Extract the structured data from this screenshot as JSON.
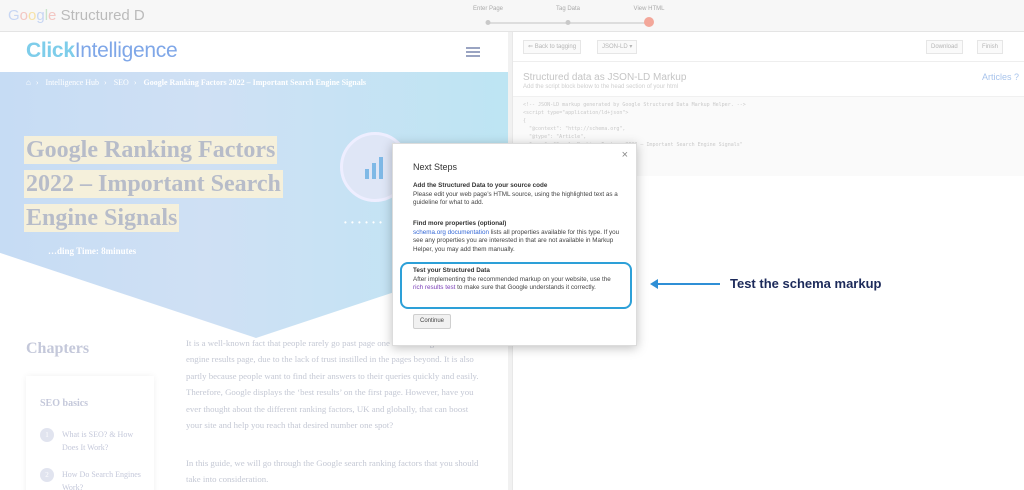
{
  "topbar": {
    "logo": {
      "google": "Google",
      "product": "Structured D"
    },
    "steps": [
      {
        "label": "Enter Page"
      },
      {
        "label": "Tag Data"
      },
      {
        "label": "View HTML"
      }
    ],
    "active_step": "View HTML"
  },
  "site": {
    "brand_bold": "Click",
    "brand_light": "Intelligence",
    "breadcrumb": [
      "Intelligence Hub",
      "SEO",
      "Google Ranking Factors 2022 – Important Search Engine Signals"
    ],
    "hero_title_lines": [
      "Google Ranking Factors",
      "2022 – Important Search",
      "Engine Signals"
    ],
    "reading_time": "…ding Time: 8minutes",
    "chapters_heading": "Chapters",
    "seo_card": {
      "heading": "SEO basics",
      "items": [
        {
          "num": "1",
          "text": "What is SEO? & How Does It Work?"
        },
        {
          "num": "2",
          "text": "How Do Search Engines Work?"
        }
      ]
    },
    "body_paragraph_1": "It is a well-known fact that people rarely go past page one of the Google search engine results page, due to the lack of trust instilled in the pages beyond. It is also partly because people want to find their answers to their queries quickly and easily. Therefore, Google displays the ‘best results’ on the first page. However, have you ever thought about the different ranking factors, UK and globally, that can boost your site and help you reach that desired number one spot?",
    "body_paragraph_2": "In this guide, we will go through the Google search ranking factors that you should take into consideration."
  },
  "panel": {
    "back_button": "Back to tagging",
    "format_select": "JSON-LD",
    "download_button": "Download",
    "finish_button": "Finish",
    "title": "Structured data as JSON-LD Markup",
    "subtitle": "Add the script block below to the head section of your html",
    "articles_label": "Articles",
    "code_lines": [
      "<!-- JSON-LD markup generated by Google Structured Data Markup Helper. -->",
      "<script type=\"application/ld+json\">",
      "{",
      "  \"@context\": \"http://schema.org\",",
      "  \"@type\": \"Article\",",
      "  \"name\": \"Google Ranking Factors 2022 – Important Search Engine Signals\"",
      "}"
    ]
  },
  "modal": {
    "title": "Next Steps",
    "close_symbol": "×",
    "sections": [
      {
        "heading": "Add the Structured Data to your source code",
        "text": "Please edit your web page’s HTML source, using the highlighted text as a guideline for what to add."
      },
      {
        "heading": "Find more properties (optional)",
        "link": "schema.org documentation",
        "text": " lists all properties available for this type. If you see any properties you are interested in that are not available in Markup Helper, you may add them manually."
      },
      {
        "heading": "Test your Structured Data",
        "text_before": "After implementing the recommended markup on your website, use the ",
        "link": "rich results test",
        "text_after": " to make sure that Google understands it correctly."
      }
    ],
    "continue_button": "Continue"
  },
  "annotation": {
    "text": "Test the schema markup",
    "color": "#2f8fd6"
  }
}
